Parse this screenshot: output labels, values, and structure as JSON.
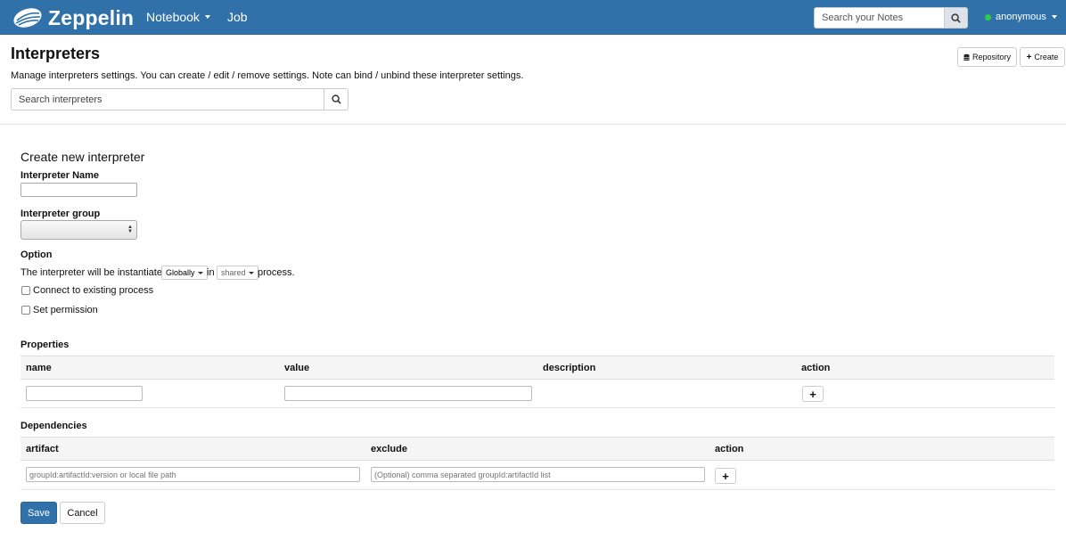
{
  "navbar": {
    "brand": "Zeppelin",
    "notebook_label": "Notebook",
    "job_label": "Job",
    "search_placeholder": "Search your Notes",
    "user": "anonymous"
  },
  "header": {
    "title": "Interpreters",
    "description": "Manage interpreters settings. You can create / edit / remove settings. Note can bind / unbind these interpreter settings.",
    "repository_label": "Repository",
    "create_label": "Create",
    "search_placeholder": "Search interpreters"
  },
  "form": {
    "section_title": "Create new interpreter",
    "name_label": "Interpreter Name",
    "group_label": "Interpreter group",
    "option_label": "Option",
    "instantiate_prefix": "The interpreter will be instantiated",
    "instantiate_mode": "Globally",
    "instantiate_in": "in",
    "process_mode": "shared",
    "instantiate_suffix": "process.",
    "connect_existing_label": "Connect to existing process",
    "set_permission_label": "Set permission"
  },
  "properties": {
    "title": "Properties",
    "columns": [
      "name",
      "value",
      "description",
      "action"
    ]
  },
  "dependencies": {
    "title": "Dependencies",
    "columns": [
      "artifact",
      "exclude",
      "action"
    ],
    "artifact_placeholder": "groupId:artifactId:version or local file path",
    "exclude_placeholder": "(Optional) comma separated groupId:artifactId list"
  },
  "actions": {
    "save_label": "Save",
    "cancel_label": "Cancel"
  },
  "colors": {
    "navbar": "#3071a9",
    "primary": "#3071a9",
    "status_online": "#2ecc40"
  }
}
